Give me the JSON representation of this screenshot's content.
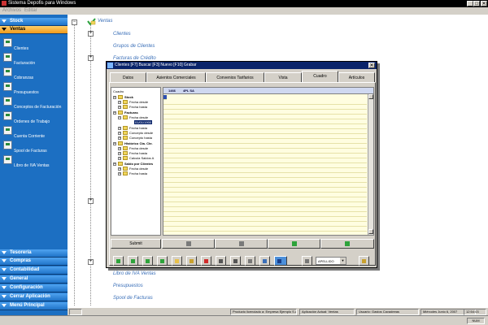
{
  "window": {
    "title": "Sistema Depofis para Windows",
    "minimize": "_",
    "maximize": "□",
    "close": "✕"
  },
  "menu": [
    "Archivos",
    "Editar"
  ],
  "sidebar": {
    "top_groups": [
      {
        "label": "Stock"
      },
      {
        "label": "Ventas"
      }
    ],
    "items": [
      {
        "label": "Clientes",
        "icon": "clients-icon"
      },
      {
        "label": "Facturación",
        "icon": "invoice-icon"
      },
      {
        "label": "Cobranzas",
        "icon": "collections-icon"
      },
      {
        "label": "Presupuestos",
        "icon": "budget-icon"
      },
      {
        "label": "Conceptos de Facturación",
        "icon": "concepts-icon"
      },
      {
        "label": "Ordenes de Trabajo",
        "icon": "work-orders-icon"
      },
      {
        "label": "Cuenta Corriente",
        "icon": "account-icon"
      },
      {
        "label": "Spool de Facturas",
        "icon": "spool-icon"
      },
      {
        "label": "Libro de IVA Ventas",
        "icon": "vat-book-icon"
      }
    ],
    "bottom_groups": [
      {
        "label": "Tesorería"
      },
      {
        "label": "Compras"
      },
      {
        "label": "Contabilidad"
      },
      {
        "label": "General"
      },
      {
        "label": "Configuración"
      },
      {
        "label": "Cerrar Aplicación"
      },
      {
        "label": "Menú Principal"
      }
    ]
  },
  "tree": {
    "root": "Ventas",
    "nodes": [
      "Clientes",
      "Grupos de Clientes",
      "Facturas de Crédito",
      "Libro de IVA Ventas",
      "Presupuestos",
      "Spool de Facturas"
    ]
  },
  "dialog": {
    "title": "Clientes  [F7] Buscar   [F3] Nuevo   [F10] Grabar",
    "tabs": [
      "Datos",
      "Asientos Comerciales",
      "Convenios Tarifarios",
      "Vista",
      "Cuadro",
      "Artículos"
    ],
    "active_tab": "Cuadro",
    "tree": [
      {
        "label": "Cuadro",
        "level": 0,
        "bold": false
      },
      {
        "label": "Stock",
        "level": 1,
        "bold": true
      },
      {
        "label": "Fecha desde",
        "level": 2,
        "bold": false
      },
      {
        "label": "Fecha hasta",
        "level": 2,
        "bold": false
      },
      {
        "label": "Facturas",
        "level": 1,
        "bold": true
      },
      {
        "label": "Fecha desde",
        "level": 2,
        "bold": false
      },
      {
        "label": "01/01/1900",
        "level": 3,
        "bold": false,
        "selected": true
      },
      {
        "label": "Fecha hasta",
        "level": 2,
        "bold": false
      },
      {
        "label": "Concepto desde",
        "level": 2,
        "bold": false
      },
      {
        "label": "Concepto hasta",
        "level": 2,
        "bold": false
      },
      {
        "label": "Histórico Cta. Cte.",
        "level": 1,
        "bold": true
      },
      {
        "label": "Fecha desde",
        "level": 2,
        "bold": false
      },
      {
        "label": "Fecha hasta",
        "level": 2,
        "bold": false
      },
      {
        "label": "Calcula Saldos A",
        "level": 2,
        "bold": false
      },
      {
        "label": "Saldo por Clientes",
        "level": 1,
        "bold": true
      },
      {
        "label": "Fecha desde",
        "level": 2,
        "bold": false
      },
      {
        "label": "Fecha hasta",
        "level": 2,
        "bold": false
      }
    ],
    "grid": {
      "code": "1466",
      "name": "4PL SA"
    },
    "submit": "Submit",
    "combo_value": "APELLIDO"
  },
  "status": {
    "license": "Producto licenciado a: Empresa Ejemplo S.A.",
    "app": "Aplicación Actual: Ventas",
    "user": "Usuario: Gastos Cavadeeas",
    "date": "Miércoles Junio 6, 2007",
    "time": "12:54:03",
    "num": "NUM"
  }
}
